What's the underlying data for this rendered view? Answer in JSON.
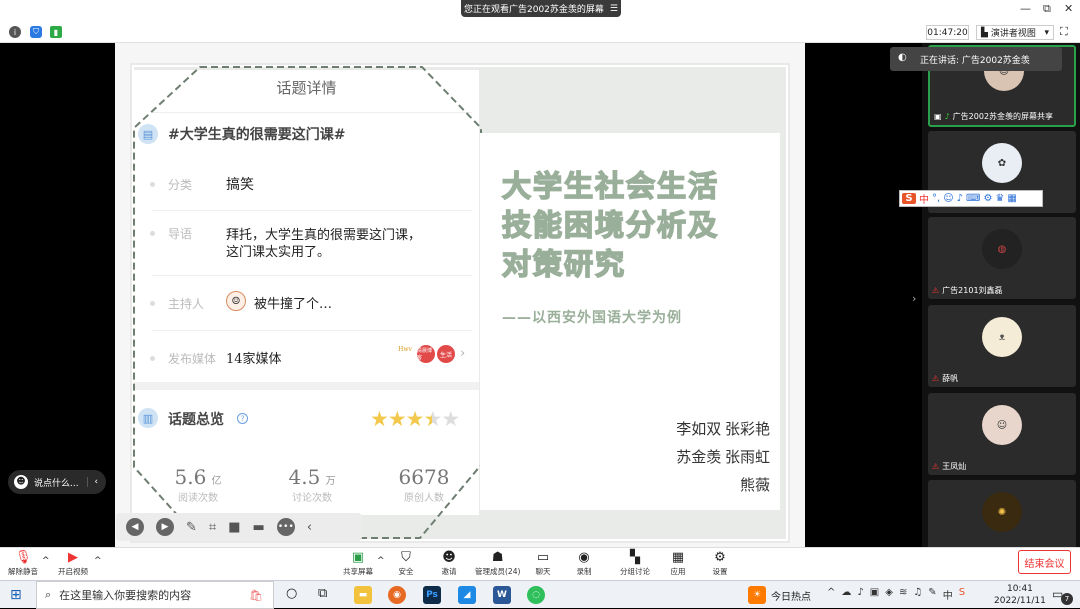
{
  "banner": {
    "text": "您正在观看广告2002苏金羡的屏幕",
    "menu_icon": "hamburger-icon"
  },
  "topbar": {
    "timer": "01:47:20",
    "view_label": "演讲者视图",
    "minimize": "—",
    "restore": "⧉",
    "close": "✕"
  },
  "panel": {
    "title": "话题详情",
    "topic": "#大学生真的很需要这门课#",
    "category_label": "分类",
    "category_value": "搞笑",
    "intro_label": "导语",
    "intro_value_1": "拜托，大学生真的很需要这门课，",
    "intro_value_2": "这门课太实用了。",
    "host_label": "主持人",
    "host_value": "被牛撞了个…",
    "media_label": "发布媒体",
    "media_value": "14家媒体",
    "media_logos": [
      "Hwv",
      "清晨博客",
      "生活"
    ],
    "overview_title": "话题总览",
    "rating": 3.5,
    "stats": [
      {
        "num": "5.6",
        "unit": "亿",
        "label": "阅读次数"
      },
      {
        "num": "4.5",
        "unit": "万",
        "label": "讨论次数"
      },
      {
        "num": "6678",
        "unit": "",
        "label": "原创人数"
      }
    ]
  },
  "slide": {
    "title_lines": [
      "大学生社会生活",
      "技能困境分析及",
      "对策研究"
    ],
    "subtitle": "——以西安外国语大学为例",
    "authors": [
      "李如双 张彩艳",
      "苏金羡 张雨虹",
      "熊薇"
    ],
    "title_color": "#9aaf9a"
  },
  "sidebar": {
    "speaking": "正在讲话: 广告2002苏金羡",
    "share_label": "广告2002苏金羡的屏幕共享",
    "participants": [
      "广告2101刘鑫磊",
      "薛帆",
      "王凤灿"
    ],
    "ime_label": "中"
  },
  "chat": {
    "placeholder": "说点什么..."
  },
  "toolbar": {
    "mute": "解除静音",
    "video": "开启视频",
    "share": "共享屏幕",
    "security": "安全",
    "invite": "邀请",
    "members": "管理成员(24)",
    "chat": "聊天",
    "record": "录制",
    "breakout": "分组讨论",
    "apps": "应用",
    "settings": "设置",
    "leave": "结束会议"
  },
  "taskbar": {
    "search_placeholder": "在这里输入你要搜索的内容",
    "hot": "今日热点",
    "time": "10:41",
    "date": "2022/11/11",
    "notif_count": "7"
  }
}
